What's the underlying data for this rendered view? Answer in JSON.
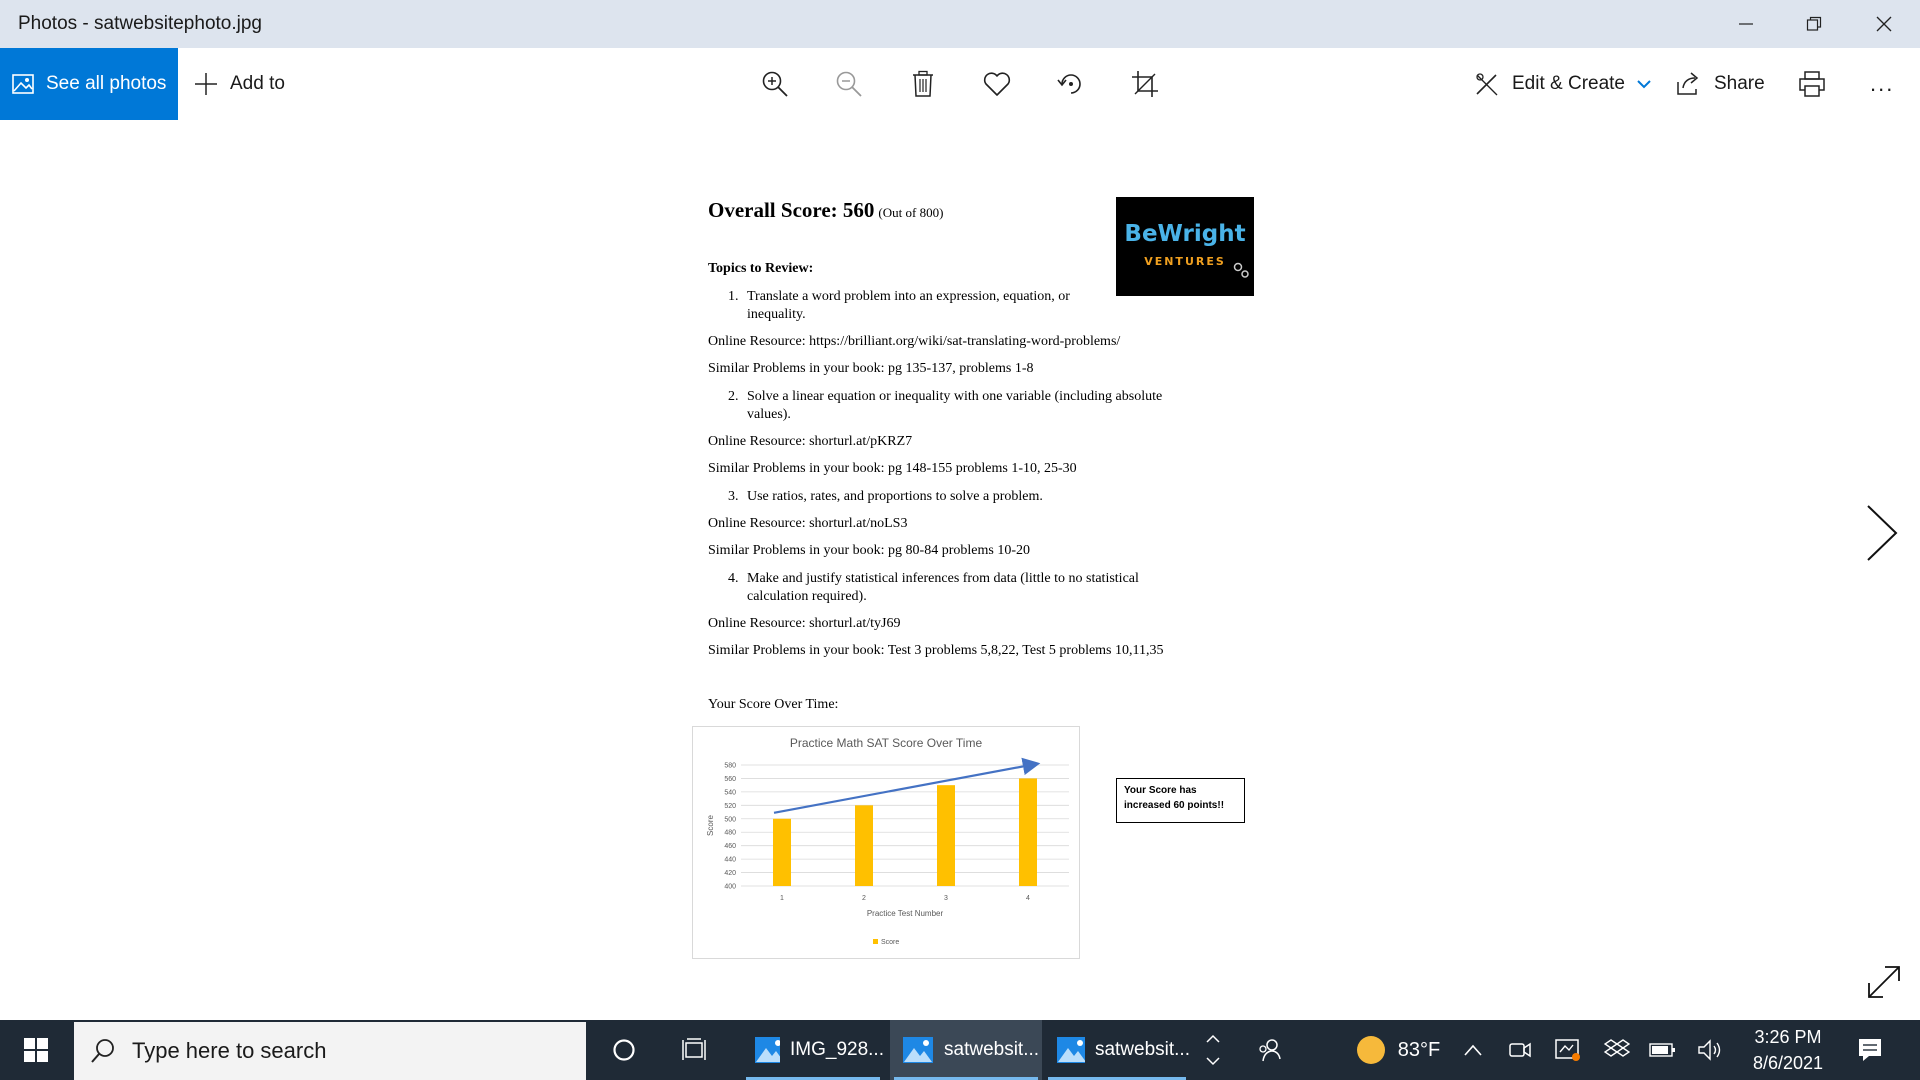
{
  "window": {
    "title": "Photos - satwebsitephoto.jpg"
  },
  "toolbar": {
    "see_all_photos": "See all photos",
    "add_to": "Add to",
    "edit_create": "Edit & Create",
    "share": "Share",
    "more": "...",
    "icons": [
      "zoom-in-icon",
      "zoom-out-icon",
      "delete-icon",
      "favorite-icon",
      "rotate-icon",
      "crop-icon",
      "print-icon"
    ]
  },
  "document": {
    "overall_label": "Overall Score: 560",
    "overall_sub": "(Out of 800)",
    "logo_top": "BeWright",
    "logo_bottom": "VENTURES",
    "topics_heading": "Topics to Review:",
    "topics": [
      {
        "num": "1.",
        "line1": "Translate a word problem into an expression, equation, or",
        "line2": "inequality.",
        "resource": "Online Resource: https://brilliant.org/wiki/sat-translating-word-problems/",
        "similar": "Similar Problems in your book: pg 135-137, problems 1-8"
      },
      {
        "num": "2.",
        "line1": "Solve a linear equation or inequality with one variable (including absolute",
        "line2": "values).",
        "resource": "Online Resource: shorturl.at/pKRZ7",
        "similar": "Similar Problems in your book: pg 148-155 problems 1-10, 25-30"
      },
      {
        "num": "3.",
        "line1": "Use ratios, rates, and proportions to solve a problem.",
        "line2": "",
        "resource": "Online Resource: shorturl.at/noLS3",
        "similar": "Similar Problems in your book: pg 80-84 problems 10-20"
      },
      {
        "num": "4.",
        "line1": "Make and justify statistical inferences from data (little to no statistical",
        "line2": "calculation required).",
        "resource": "Online Resource: shorturl.at/tyJ69",
        "similar": "Similar Problems in your book: Test 3 problems 5,8,22, Test 5 problems 10,11,35"
      }
    ],
    "score_over_time": "Your Score Over Time:",
    "callout_line1": "Your Score has",
    "callout_line2": "increased 60 points!!"
  },
  "chart_data": {
    "type": "bar",
    "title": "Practice Math SAT Score Over Time",
    "xlabel": "Practice Test Number",
    "ylabel": "Score",
    "categories": [
      "1",
      "2",
      "3",
      "4"
    ],
    "series": [
      {
        "name": "Score",
        "values": [
          500,
          520,
          550,
          560
        ],
        "color": "#ffc000"
      }
    ],
    "ylim": [
      400,
      580
    ],
    "yticks": [
      400,
      420,
      440,
      460,
      480,
      500,
      520,
      540,
      560,
      580
    ],
    "trend_arrow_color": "#4472c4",
    "grid": true,
    "legend": "bottom"
  },
  "taskbar": {
    "search_placeholder": "Type here to search",
    "apps": [
      {
        "label": "IMG_928...",
        "active": false
      },
      {
        "label": "satwebsit...",
        "active": true
      },
      {
        "label": "satwebsit...",
        "active": false
      }
    ],
    "weather": "83°F",
    "time": "3:26 PM",
    "date": "8/6/2021"
  },
  "colors": {
    "accent": "#0078d7",
    "titlebar": "#dde4ee",
    "taskbar": "#1f2a36"
  }
}
